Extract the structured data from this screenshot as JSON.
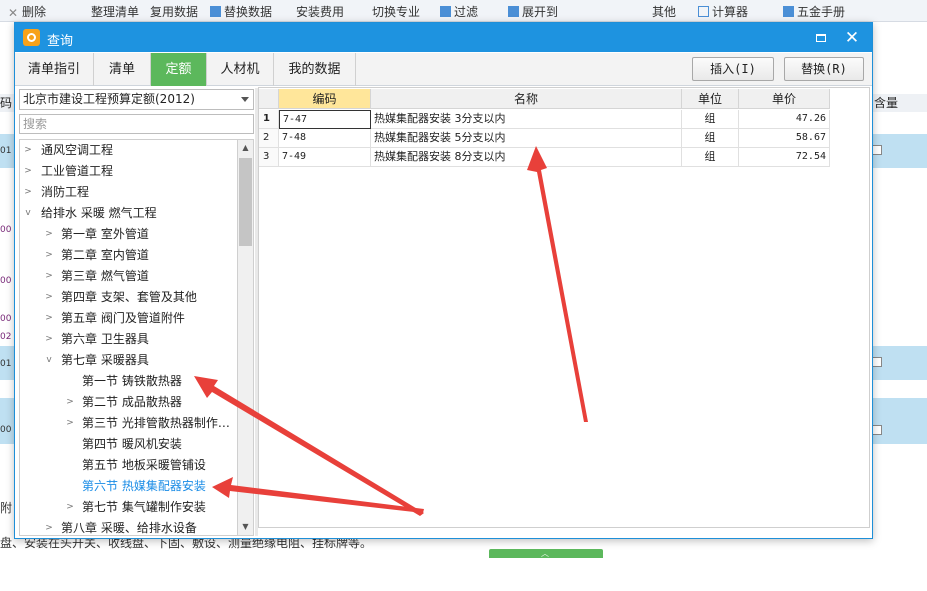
{
  "background": {
    "toolbar_items": [
      "删除",
      "整理清单",
      "复用数据",
      "替换数据",
      "安装费用",
      "切换专业",
      "过滤",
      "展开到",
      "其他",
      "计算器",
      "五金手册"
    ],
    "right_header": "含量",
    "left_header": "码",
    "left_rows": [
      "01",
      "00",
      "00",
      "00",
      "02",
      "01",
      "00",
      "附"
    ],
    "bottom_note": "盘、安装在头开关、收线盘、下固、敷设、测量绝缘电阻、挂标牌等。"
  },
  "dialog": {
    "title": "查询",
    "tabs": [
      "清单指引",
      "清单",
      "定额",
      "人材机",
      "我的数据"
    ],
    "active_tab": "定额",
    "insert_label": "插入(I)",
    "replace_label": "替换(R)"
  },
  "left_panel": {
    "quota_library": "北京市建设工程预算定额(2012)",
    "search_placeholder": "搜索",
    "tree": [
      {
        "label": "通风空调工程",
        "expanded": false
      },
      {
        "label": "工业管道工程",
        "expanded": false
      },
      {
        "label": "消防工程",
        "expanded": false
      },
      {
        "label": "给排水 采暖 燃气工程",
        "expanded": true
      },
      {
        "label": "第一章 室外管道",
        "expanded": false
      },
      {
        "label": "第二章 室内管道",
        "expanded": false
      },
      {
        "label": "第三章 燃气管道",
        "expanded": false
      },
      {
        "label": "第四章 支架、套管及其他",
        "expanded": false
      },
      {
        "label": "第五章 阀门及管道附件",
        "expanded": false
      },
      {
        "label": "第六章 卫生器具",
        "expanded": false
      },
      {
        "label": "第七章 采暖器具",
        "expanded": true
      },
      {
        "label": "第一节 铸铁散热器",
        "expanded": null
      },
      {
        "label": "第二节 成品散热器",
        "expanded": false
      },
      {
        "label": "第三节 光排管散热器制作…",
        "expanded": false
      },
      {
        "label": "第四节 暖风机安装",
        "expanded": null
      },
      {
        "label": "第五节 地板采暖管铺设",
        "expanded": null
      },
      {
        "label": "第六节 热媒集配器安装",
        "expanded": null,
        "selected": true
      },
      {
        "label": "第七节 集气罐制作安装",
        "expanded": false
      },
      {
        "label": "第八章 采暖、给排水设备",
        "expanded": false
      }
    ]
  },
  "grid": {
    "headers": [
      "编码",
      "名称",
      "单位",
      "单价"
    ],
    "rows": [
      {
        "num": "1",
        "code": "7-47",
        "name": "热媒集配器安装 3分支以内",
        "unit": "组",
        "price": "47.26"
      },
      {
        "num": "2",
        "code": "7-48",
        "name": "热媒集配器安装 5分支以内",
        "unit": "组",
        "price": "58.67"
      },
      {
        "num": "3",
        "code": "7-49",
        "name": "热媒集配器安装 8分支以内",
        "unit": "组",
        "price": "72.54"
      }
    ]
  },
  "colors": {
    "titlebar": "#1e93e0",
    "active_tab": "#5cb85c",
    "code_header": "#ffe69a",
    "selected_tree_text": "#1a8ce6",
    "annotation_arrow": "#e8403a"
  }
}
